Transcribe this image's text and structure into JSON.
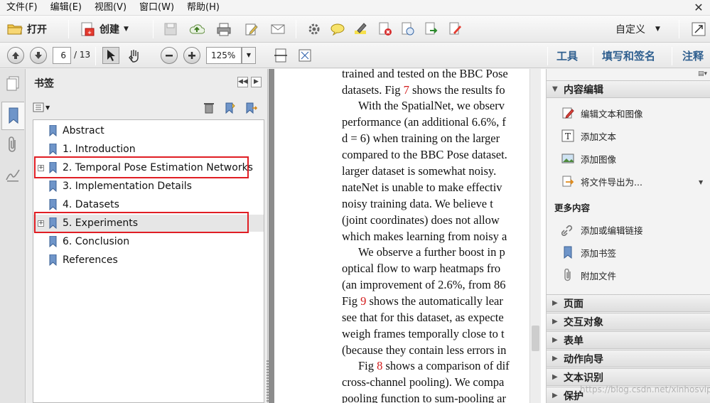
{
  "menubar": {
    "items": [
      "文件(F)",
      "编辑(E)",
      "视图(V)",
      "窗口(W)",
      "帮助(H)"
    ]
  },
  "toolbar1": {
    "open_label": "打开",
    "create_label": "创建",
    "customize_label": "自定义"
  },
  "toolbar2": {
    "page_number": "6",
    "page_total": "/ 13",
    "zoom": "125%",
    "tools_label": "工具",
    "fill_sign_label": "填写和签名",
    "comment_label": "注释"
  },
  "bookmarks": {
    "title": "书签",
    "items": [
      {
        "label": "Abstract",
        "expandable": false
      },
      {
        "label": "1. Introduction",
        "expandable": false
      },
      {
        "label": "2. Temporal Pose Estimation Networks",
        "expandable": true
      },
      {
        "label": "3. Implementation Details",
        "expandable": false
      },
      {
        "label": "4. Datasets",
        "expandable": false
      },
      {
        "label": "5. Experiments",
        "expandable": true
      },
      {
        "label": "6. Conclusion",
        "expandable": false
      },
      {
        "label": "References",
        "expandable": false
      }
    ]
  },
  "document": {
    "lines": [
      "trained and tested on the BBC Pose",
      "datasets. Fig 7 shows the results fo",
      "With the SpatialNet, we observ",
      "performance (an additional 6.6%, f",
      "d = 6) when training on the larger",
      "compared to the BBC Pose dataset.",
      "larger dataset is somewhat noisy.",
      "nateNet is unable to make effectiv",
      "noisy training data.  We believe t",
      "(joint coordinates) does not allow",
      "which makes learning from noisy a",
      "We observe a further boost in p",
      "optical flow to warp heatmaps fro",
      "(an improvement of 2.6%, from 86",
      "Fig 9 shows the automatically lear",
      "see that for this dataset, as expecte",
      "weigh frames temporally close to t",
      "(because they contain less errors in",
      "Fig 8 shows a comparison of dif",
      "cross-channel pooling). We compa",
      "pooling function to sum-pooling ar"
    ]
  },
  "right_panel": {
    "content_edit_title": "内容编辑",
    "content_items": [
      "编辑文本和图像",
      "添加文本",
      "添加图像",
      "将文件导出为..."
    ],
    "more_title": "更多内容",
    "more_items": [
      "添加或编辑链接",
      "添加书签",
      "附加文件"
    ],
    "sections": [
      "页面",
      "交互对象",
      "表单",
      "动作向导",
      "文本识别",
      "保护"
    ]
  },
  "watermark": "https://blog.csdn.net/xinhosvip",
  "colors": {
    "highlight_box": "#e01e24",
    "ref_link": "#d21a1a",
    "link_blue": "#2f5f8f"
  }
}
